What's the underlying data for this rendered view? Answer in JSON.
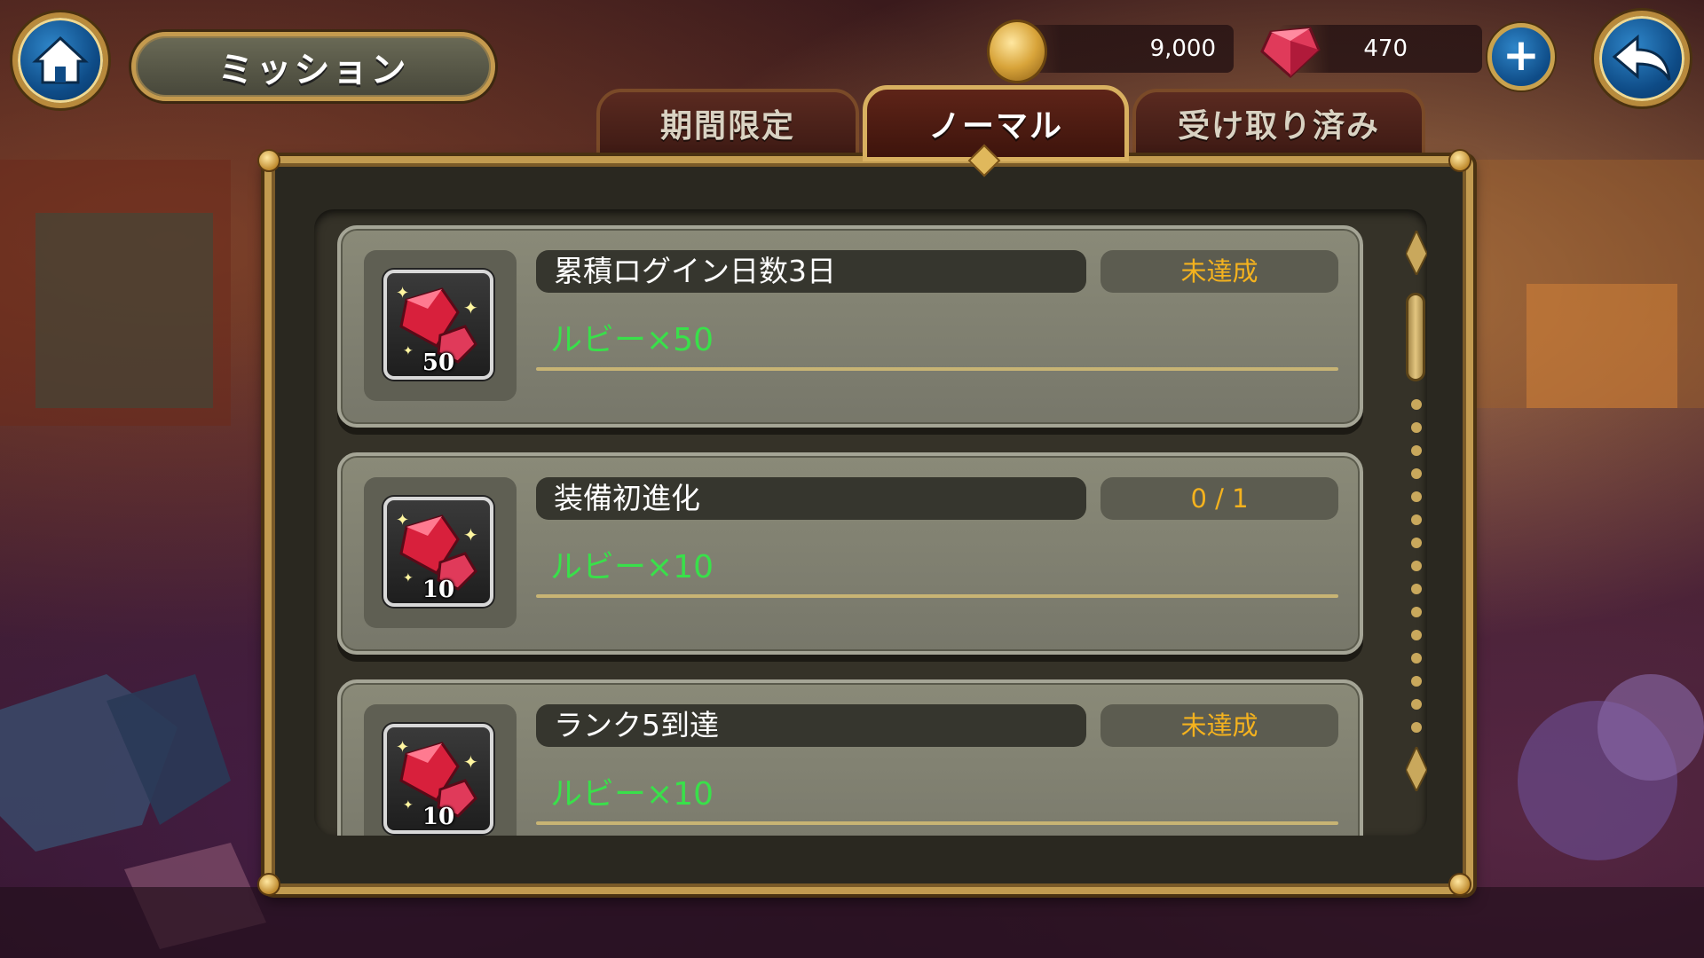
{
  "screen": {
    "title": "ミッション"
  },
  "currency": {
    "coins": "9,000",
    "rubies": "470"
  },
  "tabs": [
    {
      "label": "期間限定",
      "active": false
    },
    {
      "label": "ノーマル",
      "active": true
    },
    {
      "label": "受け取り済み",
      "active": false
    }
  ],
  "missions": [
    {
      "title": "累積ログイン日数3日",
      "status": "未達成",
      "reward": "ルビー×50",
      "icon_quantity": "50",
      "icon": "ruby-icon"
    },
    {
      "title": "装備初進化",
      "status": "0 / 1",
      "reward": "ルビー×10",
      "icon_quantity": "10",
      "icon": "ruby-icon"
    },
    {
      "title": "ランク5到達",
      "status": "未達成",
      "reward": "ルビー×10",
      "icon_quantity": "10",
      "icon": "ruby-icon"
    }
  ],
  "icons": {
    "home": "home-icon",
    "back": "back-arrow-icon",
    "coin": "coin-icon",
    "ruby": "ruby-icon",
    "add": "plus-icon"
  },
  "colors": {
    "status_text": "#f4b21e",
    "reward_text": "#39e04a",
    "frame_gold": "#c29b50",
    "button_blue": "#0e4b86"
  }
}
